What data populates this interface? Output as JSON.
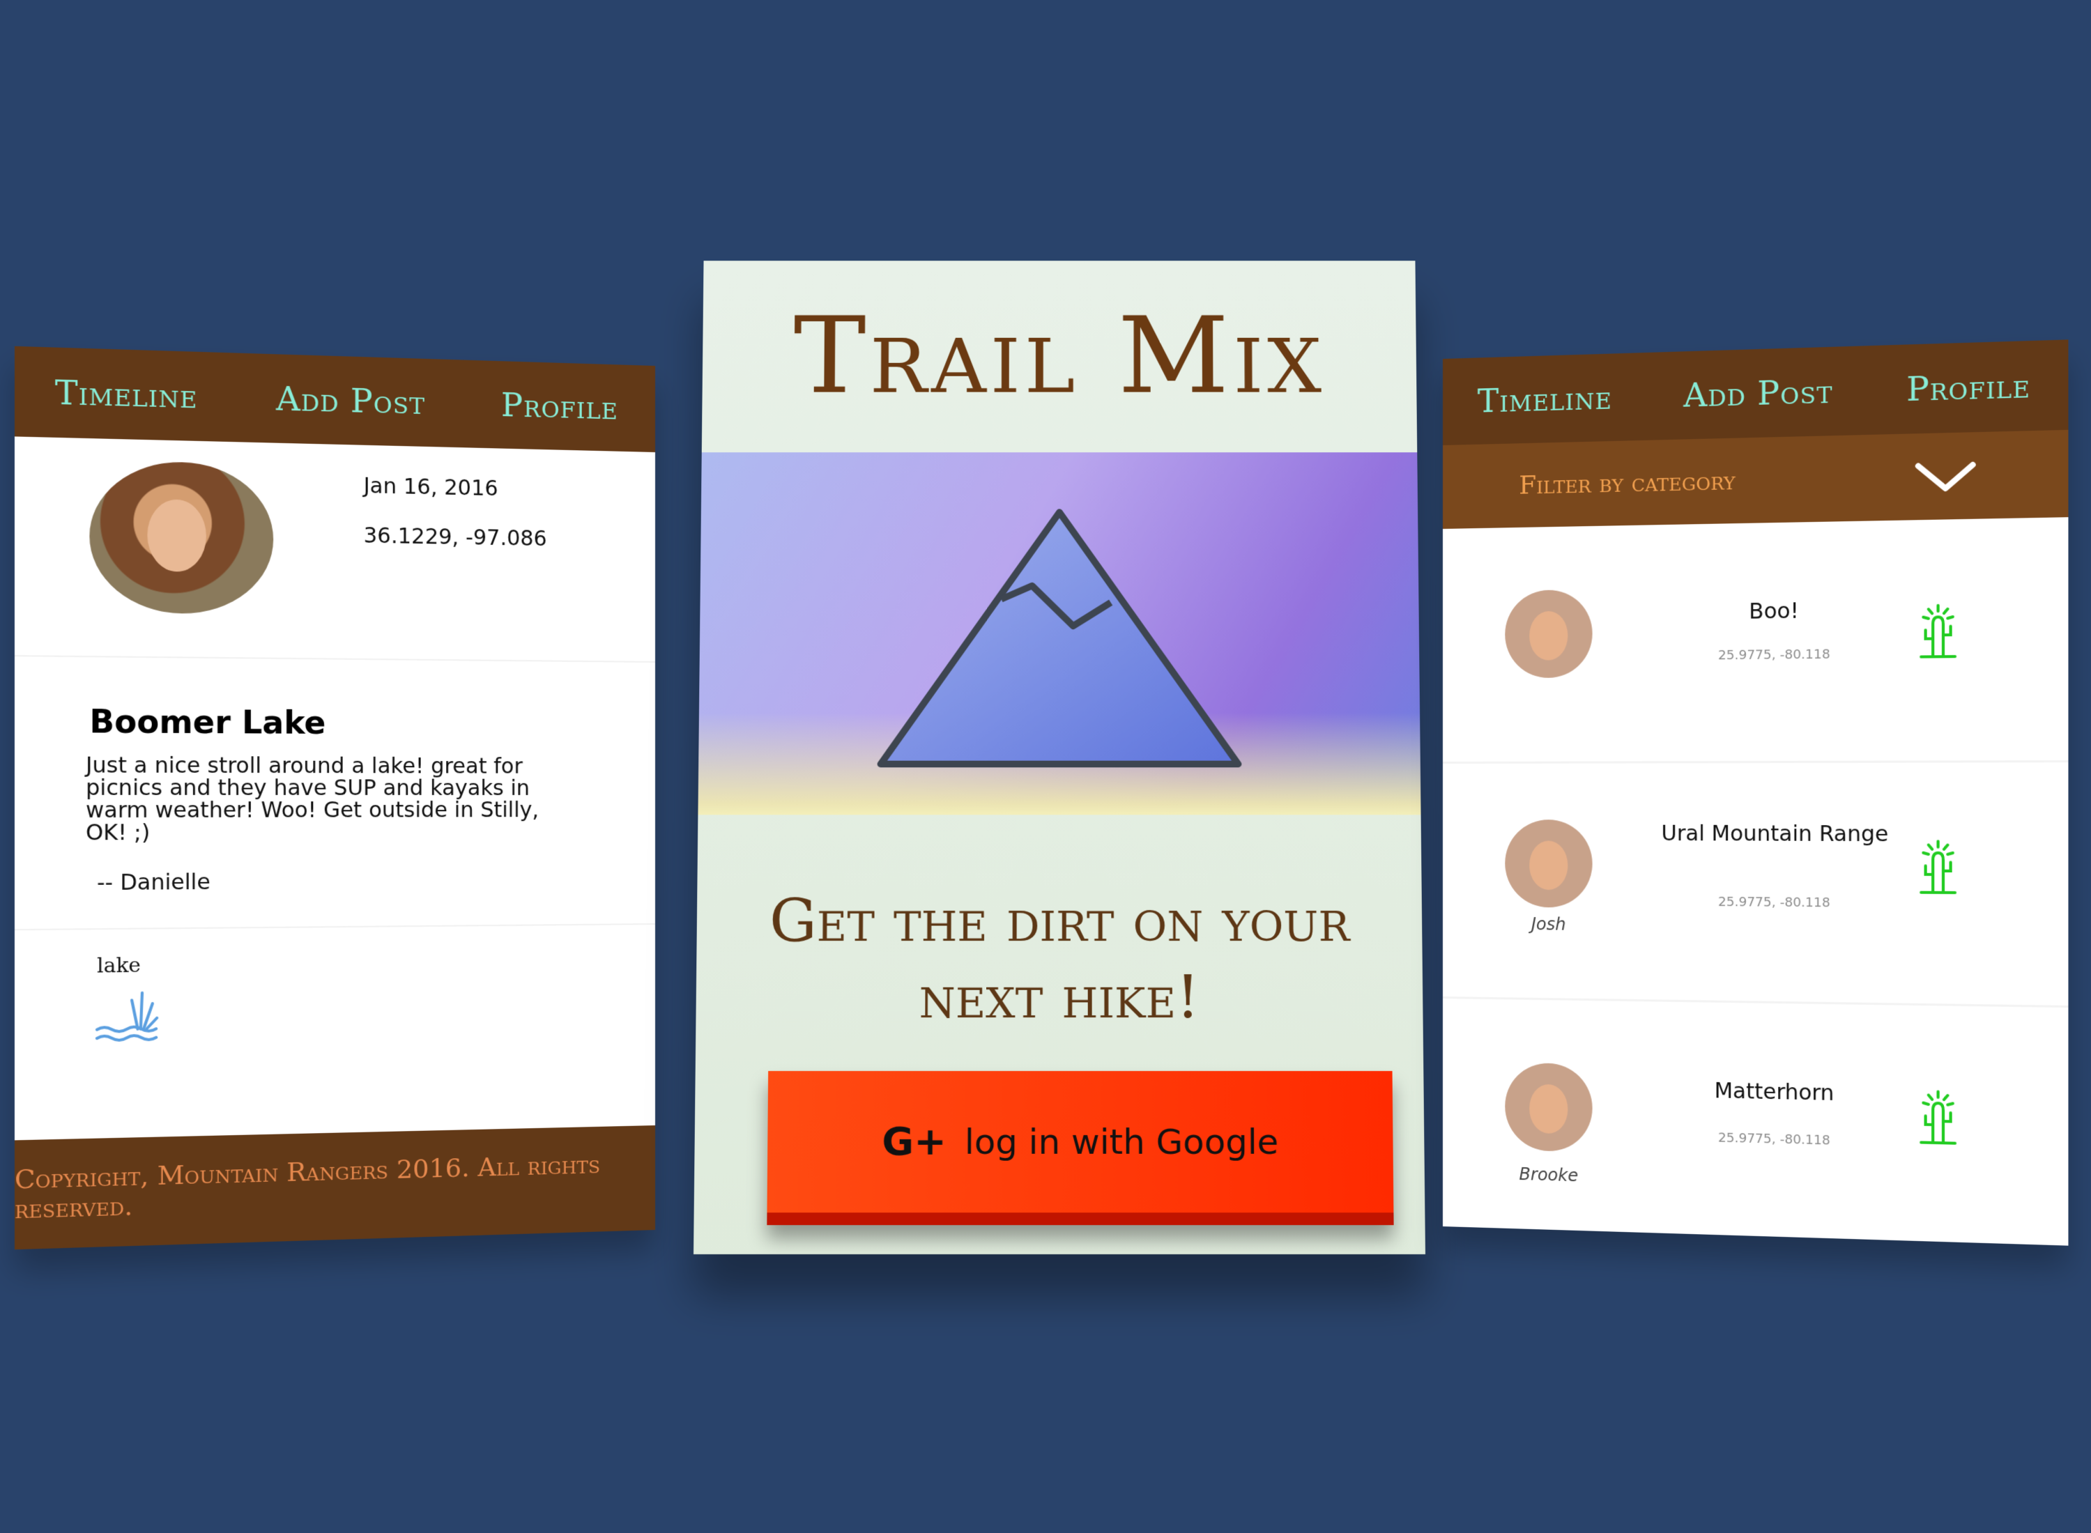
{
  "nav": {
    "timeline": "Timeline",
    "add_post": "Add Post",
    "profile": "Profile"
  },
  "post_detail": {
    "date": "Jan 16, 2016",
    "coords": "36.1229, -97.086",
    "title": "Boomer Lake",
    "body": "Just a nice stroll around a lake! great for picnics and they have SUP and kayaks in warm weather! Woo! Get outside in Stilly, OK! ;)",
    "author": "-- Danielle",
    "category_label": "lake",
    "category_icon": "lake-icon",
    "footer": "Copyright, Mountain Rangers 2016. All rights reserved."
  },
  "login": {
    "brand": "Trail Mix",
    "hero_icon": "mountain-icon",
    "tagline": "Get the dirt on your next hike!",
    "button_icon": "G+",
    "button_label": "log in with Google",
    "button_color": "#ff3300"
  },
  "timeline": {
    "filter_label": "Filter by category",
    "filter_icon": "chevron-down-icon",
    "items": [
      {
        "title": "Boo!",
        "coords": "25.9775, -80.118",
        "user": "",
        "icon": "cactus-icon"
      },
      {
        "title": "Ural Mountain Range",
        "coords": "25.9775, -80.118",
        "user": "Josh",
        "icon": "cactus-icon"
      },
      {
        "title": "Matterhorn",
        "coords": "25.9775, -80.118",
        "user": "Brooke",
        "icon": "cactus-icon"
      }
    ]
  },
  "colors": {
    "background": "#29436b",
    "nav_bar": "#623917",
    "nav_text": "#88ecd6",
    "filter_bar": "#7a481c",
    "filter_text": "#f3a150",
    "brand_text": "#6b3a12",
    "category_icon_green": "#22cc22"
  }
}
